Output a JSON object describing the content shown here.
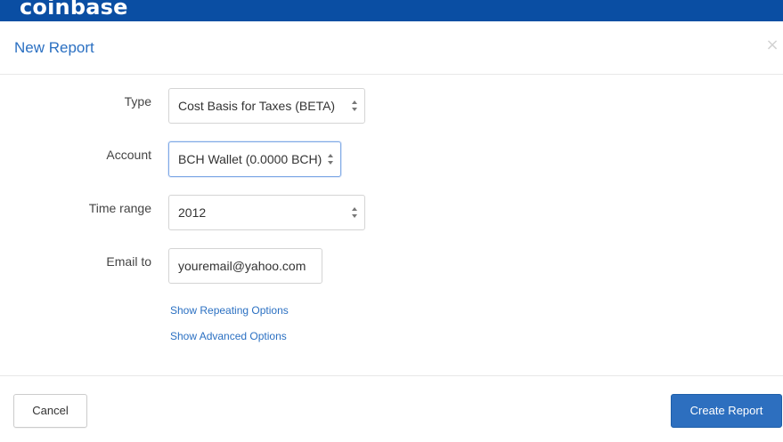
{
  "brand": {
    "name": "coinbase",
    "color": "#0a4ea3"
  },
  "modal": {
    "title": "New Report",
    "close_symbol": "×"
  },
  "form": {
    "type": {
      "label": "Type",
      "value": "Cost Basis for Taxes (BETA)"
    },
    "account": {
      "label": "Account",
      "value": "BCH Wallet (0.0000 BCH)"
    },
    "time_range": {
      "label": "Time range",
      "value": "2012"
    },
    "email": {
      "label": "Email to",
      "value": "youremail@yahoo.com"
    }
  },
  "links": {
    "repeating": "Show Repeating Options",
    "advanced": "Show Advanced Options"
  },
  "buttons": {
    "cancel": "Cancel",
    "create": "Create Report"
  },
  "colors": {
    "accent": "#2b70c2",
    "primary_button": "#2d6fbf"
  }
}
